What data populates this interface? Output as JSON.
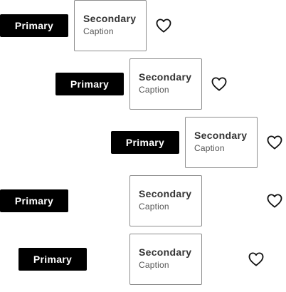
{
  "rows": [
    {
      "primary_label": "Primary",
      "secondary_title": "Secondary",
      "secondary_caption": "Caption",
      "icon": "heart-outline-icon"
    },
    {
      "primary_label": "Primary",
      "secondary_title": "Secondary",
      "secondary_caption": "Caption",
      "icon": "heart-outline-icon"
    },
    {
      "primary_label": "Primary",
      "secondary_title": "Secondary",
      "secondary_caption": "Caption",
      "icon": "heart-outline-icon"
    },
    {
      "primary_label": "Primary",
      "secondary_title": "Secondary",
      "secondary_caption": "Caption",
      "icon": "heart-outline-icon"
    },
    {
      "primary_label": "Primary",
      "secondary_title": "Secondary",
      "secondary_caption": "Caption",
      "icon": "heart-outline-icon"
    }
  ],
  "colors": {
    "primary_bg": "#000000",
    "primary_text": "#ffffff",
    "secondary_border": "#8e8e8e",
    "secondary_title": "#333333",
    "secondary_caption": "#555555",
    "icon_stroke": "#111111"
  }
}
